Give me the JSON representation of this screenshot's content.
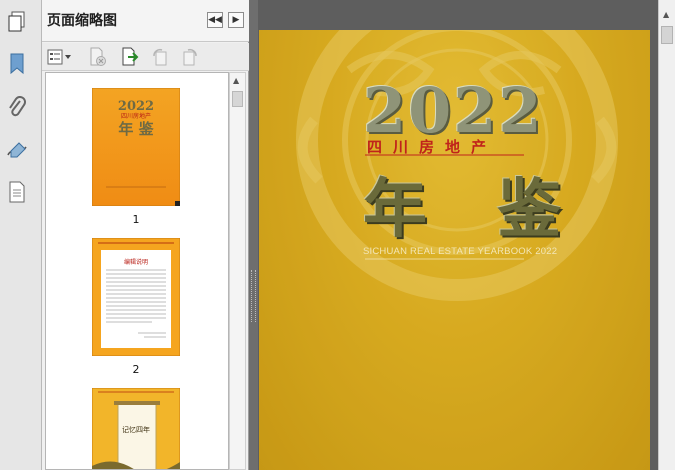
{
  "panel": {
    "title": "页面缩略图"
  },
  "thumbnails": [
    {
      "label": "1",
      "year": "2022",
      "sub": "四川房地产",
      "title": "年 鉴"
    },
    {
      "label": "2",
      "title": "编辑说明"
    },
    {
      "label": "",
      "title": "记忆四年"
    }
  ],
  "cover": {
    "year": "2022",
    "subtitle": "四川房地产",
    "title": "年 鉴",
    "english": "SICHUAN REAL ESTATE YEARBOOK 2022"
  },
  "colors": {
    "cover_gold": "#dcae23",
    "subtitle_red": "#c0231b"
  }
}
